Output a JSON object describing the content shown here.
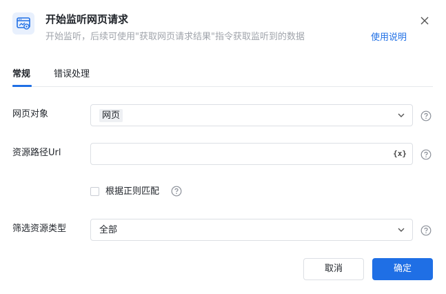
{
  "dialog": {
    "title": "开始监听网页请求",
    "subtitle": "开始监听，后续可使用\"获取网页请求结果\"指令获取监听到的数据",
    "help_link": "使用说明"
  },
  "tabs": [
    {
      "label": "常规",
      "active": true
    },
    {
      "label": "错误处理",
      "active": false
    }
  ],
  "form": {
    "web_object": {
      "label": "网页对象",
      "value": "网页"
    },
    "resource_url": {
      "label": "资源路径Url",
      "value": "",
      "var_icon": "{x}"
    },
    "regex_match": {
      "label": "根据正则匹配",
      "checked": false
    },
    "resource_type": {
      "label": "筛选资源类型",
      "value": "全部"
    }
  },
  "buttons": {
    "cancel": "取消",
    "ok": "确定"
  },
  "colors": {
    "accent": "#1f6fe5",
    "border": "#dcdfe4",
    "muted_text": "#a0a4ab"
  },
  "icons": {
    "header": "network-monitor-icon",
    "close": "close-icon",
    "dropdown": "chevron-down-icon",
    "help": "question-circle-icon",
    "variable": "variable-icon"
  }
}
